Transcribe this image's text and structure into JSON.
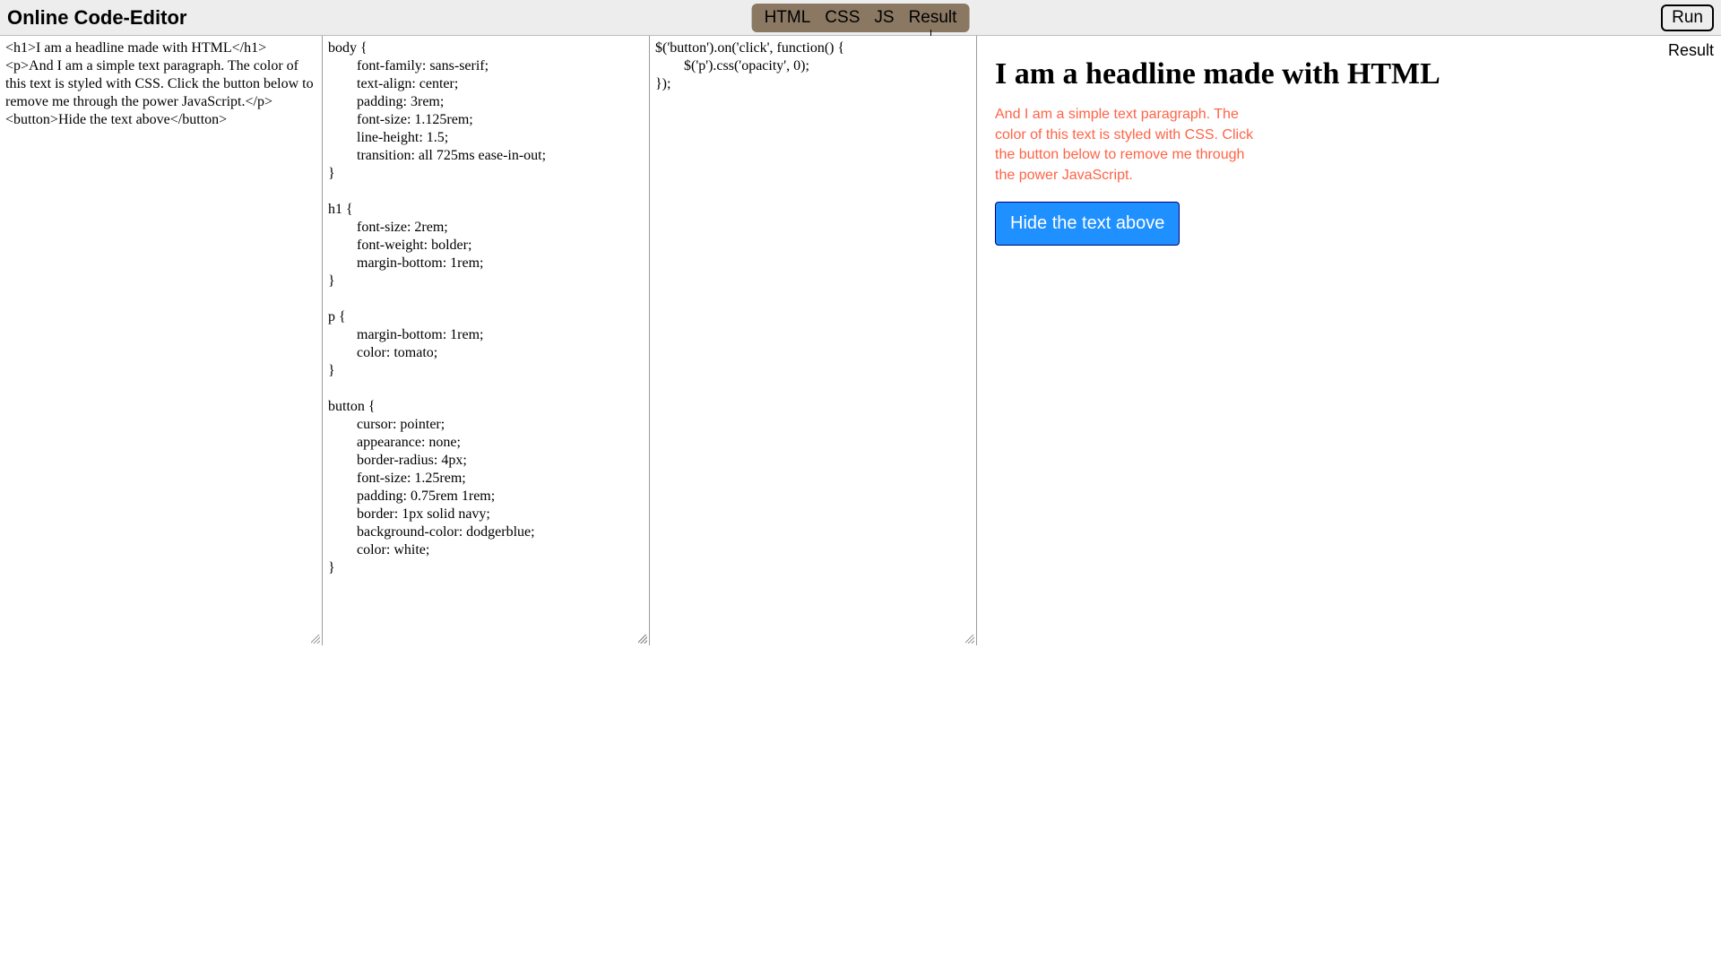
{
  "app": {
    "title": "Online Code-Editor"
  },
  "tabs": {
    "html": "HTML",
    "css": "CSS",
    "js": "JS",
    "result": "Result"
  },
  "run_label": "Run",
  "labels": {
    "html": "HTML",
    "css": "CSS",
    "js": "JS",
    "result": "Result"
  },
  "code": {
    "html": "<h1>I am a headline made with HTML</h1>\n<p>And I am a simple text paragraph. The color of this text is styled with CSS. Click the button below to remove me through the power JavaScript.</p>\n<button>Hide the text above</button>",
    "css": "body {\n        font-family: sans-serif;\n        text-align: center;\n        padding: 3rem;\n        font-size: 1.125rem;\n        line-height: 1.5;\n        transition: all 725ms ease-in-out;\n}\n\nh1 {\n        font-size: 2rem;\n        font-weight: bolder;\n        margin-bottom: 1rem;\n}\n\np {\n        margin-bottom: 1rem;\n        color: tomato;\n}\n\nbutton {\n        cursor: pointer;\n        appearance: none;\n        border-radius: 4px;\n        font-size: 1.25rem;\n        padding: 0.75rem 1rem;\n        border: 1px solid navy;\n        background-color: dodgerblue;\n        color: white;\n}",
    "js": "$('button').on('click', function() {\n        $('p').css('opacity', 0);\n});"
  },
  "result": {
    "headline": "I am a headline made with HTML",
    "paragraph": "And I am a simple text paragraph. The color of this text is styled with CSS. Click the button below to remove me through the power JavaScript.",
    "button": "Hide the text above"
  }
}
